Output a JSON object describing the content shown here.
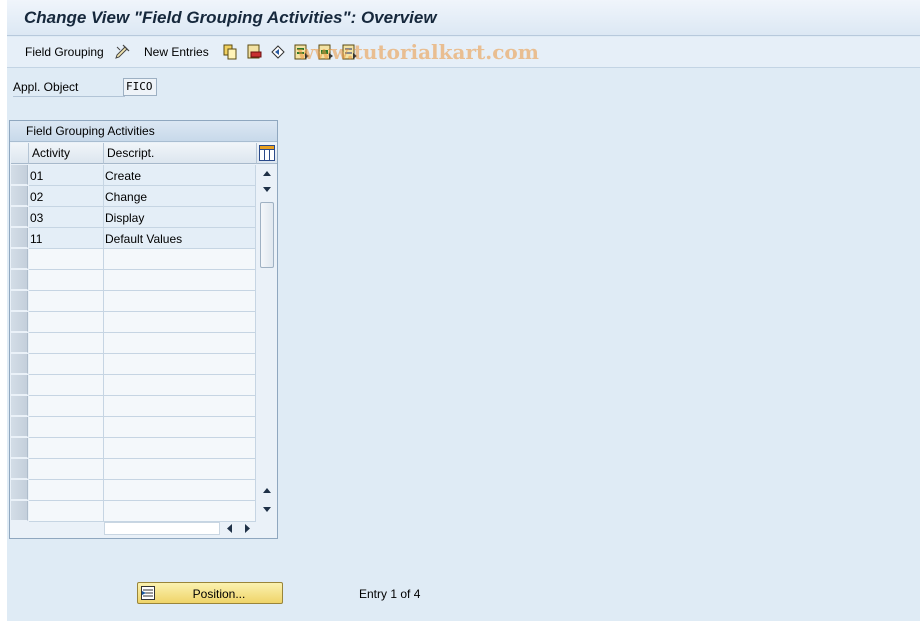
{
  "title": "Change View \"Field Grouping Activities\": Overview",
  "toolbar": {
    "field_grouping_label": "Field Grouping",
    "new_entries_label": "New Entries",
    "watermark": "www.tutorialkart.com",
    "icons": [
      "change-icon",
      "copy-icon",
      "delete-icon",
      "undo-icon",
      "select-all-icon",
      "select-block-icon",
      "deselect-all-icon"
    ]
  },
  "selection": {
    "label": "Appl. Object",
    "value": "FICO"
  },
  "table": {
    "title": "Field Grouping Activities",
    "columns": [
      "Activity",
      "Descript."
    ],
    "rows": [
      {
        "activity": "01",
        "description": "Create"
      },
      {
        "activity": "02",
        "description": "Change"
      },
      {
        "activity": "03",
        "description": "Display"
      },
      {
        "activity": "11",
        "description": "Default Values"
      }
    ],
    "empty_rows": 13
  },
  "footer": {
    "position_label": "Position...",
    "entry_info": "Entry 1 of 4"
  },
  "colors": {
    "background": "#dfebf5",
    "button_yellow": "#efd469",
    "title_text": "#16283c"
  }
}
